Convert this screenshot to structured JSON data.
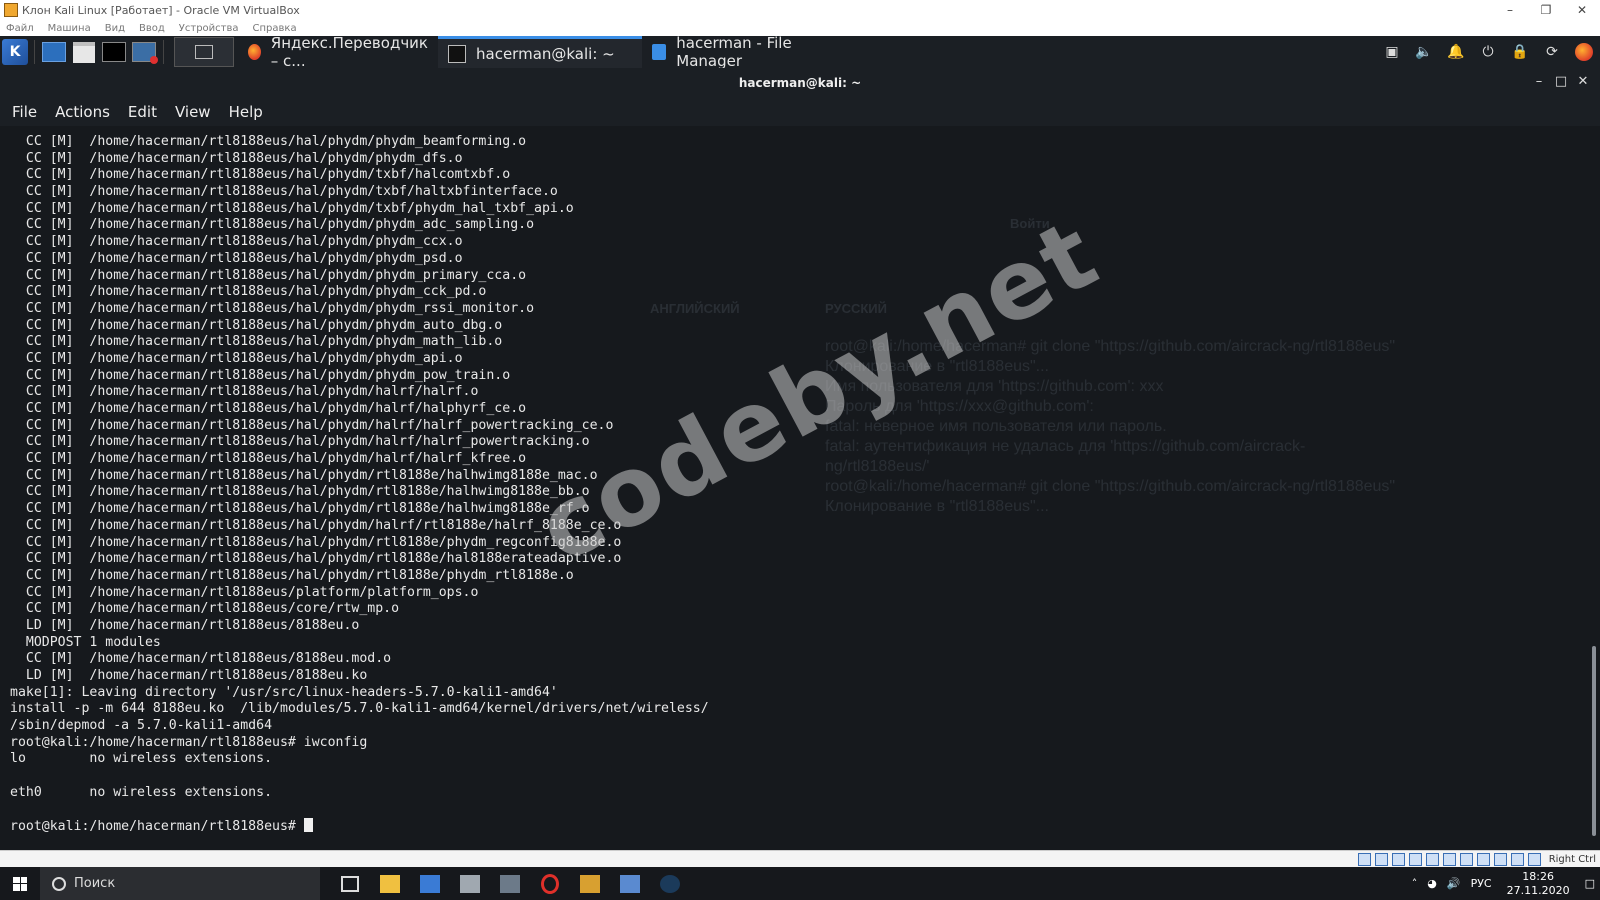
{
  "vbox": {
    "title": "Клон Kali Linux [Работает] - Oracle VM VirtualBox",
    "menu": [
      "Файл",
      "Машина",
      "Вид",
      "Ввод",
      "Устройства",
      "Справка"
    ],
    "host_key": "Right Ctrl"
  },
  "panel": {
    "tasks": [
      {
        "label": "Яндекс.Переводчик – с...",
        "icon": "firefox-icon",
        "active": false
      },
      {
        "label": "hacerman@kali: ~",
        "icon": "terminal-icon",
        "active": true
      },
      {
        "label": "hacerman - File Manager",
        "icon": "file-manager-icon",
        "active": false
      }
    ]
  },
  "terminal": {
    "title": "hacerman@kali: ~",
    "menu": [
      "File",
      "Actions",
      "Edit",
      "View",
      "Help"
    ],
    "lines": [
      "  CC [M]  /home/hacerman/rtl8188eus/hal/phydm/phydm_beamforming.o",
      "  CC [M]  /home/hacerman/rtl8188eus/hal/phydm/phydm_dfs.o",
      "  CC [M]  /home/hacerman/rtl8188eus/hal/phydm/txbf/halcomtxbf.o",
      "  CC [M]  /home/hacerman/rtl8188eus/hal/phydm/txbf/haltxbfinterface.o",
      "  CC [M]  /home/hacerman/rtl8188eus/hal/phydm/txbf/phydm_hal_txbf_api.o",
      "  CC [M]  /home/hacerman/rtl8188eus/hal/phydm/phydm_adc_sampling.o",
      "  CC [M]  /home/hacerman/rtl8188eus/hal/phydm/phydm_ccx.o",
      "  CC [M]  /home/hacerman/rtl8188eus/hal/phydm/phydm_psd.o",
      "  CC [M]  /home/hacerman/rtl8188eus/hal/phydm/phydm_primary_cca.o",
      "  CC [M]  /home/hacerman/rtl8188eus/hal/phydm/phydm_cck_pd.o",
      "  CC [M]  /home/hacerman/rtl8188eus/hal/phydm/phydm_rssi_monitor.o",
      "  CC [M]  /home/hacerman/rtl8188eus/hal/phydm/phydm_auto_dbg.o",
      "  CC [M]  /home/hacerman/rtl8188eus/hal/phydm/phydm_math_lib.o",
      "  CC [M]  /home/hacerman/rtl8188eus/hal/phydm/phydm_api.o",
      "  CC [M]  /home/hacerman/rtl8188eus/hal/phydm/phydm_pow_train.o",
      "  CC [M]  /home/hacerman/rtl8188eus/hal/phydm/halrf/halrf.o",
      "  CC [M]  /home/hacerman/rtl8188eus/hal/phydm/halrf/halphyrf_ce.o",
      "  CC [M]  /home/hacerman/rtl8188eus/hal/phydm/halrf/halrf_powertracking_ce.o",
      "  CC [M]  /home/hacerman/rtl8188eus/hal/phydm/halrf/halrf_powertracking.o",
      "  CC [M]  /home/hacerman/rtl8188eus/hal/phydm/halrf/halrf_kfree.o",
      "  CC [M]  /home/hacerman/rtl8188eus/hal/phydm/rtl8188e/halhwimg8188e_mac.o",
      "  CC [M]  /home/hacerman/rtl8188eus/hal/phydm/rtl8188e/halhwimg8188e_bb.o",
      "  CC [M]  /home/hacerman/rtl8188eus/hal/phydm/rtl8188e/halhwimg8188e_rf.o",
      "  CC [M]  /home/hacerman/rtl8188eus/hal/phydm/halrf/rtl8188e/halrf_8188e_ce.o",
      "  CC [M]  /home/hacerman/rtl8188eus/hal/phydm/rtl8188e/phydm_regconfig8188e.o",
      "  CC [M]  /home/hacerman/rtl8188eus/hal/phydm/rtl8188e/hal8188erateadaptive.o",
      "  CC [M]  /home/hacerman/rtl8188eus/hal/phydm/rtl8188e/phydm_rtl8188e.o",
      "  CC [M]  /home/hacerman/rtl8188eus/platform/platform_ops.o",
      "  CC [M]  /home/hacerman/rtl8188eus/core/rtw_mp.o",
      "  LD [M]  /home/hacerman/rtl8188eus/8188eu.o",
      "  MODPOST 1 modules",
      "  CC [M]  /home/hacerman/rtl8188eus/8188eu.mod.o",
      "  LD [M]  /home/hacerman/rtl8188eus/8188eu.ko",
      "make[1]: Leaving directory '/usr/src/linux-headers-5.7.0-kali1-amd64'",
      "install -p -m 644 8188eu.ko  /lib/modules/5.7.0-kali1-amd64/kernel/drivers/net/wireless/",
      "/sbin/depmod -a 5.7.0-kali1-amd64",
      "root@kali:/home/hacerman/rtl8188eus# iwconfig",
      "lo        no wireless extensions.",
      "",
      "eth0      no wireless extensions.",
      ""
    ],
    "prompt": "root@kali:/home/hacerman/rtl8188eus# "
  },
  "background_window": {
    "ghost_text": [
      "root@kali:/home/hacerman# git clone \"https://github.com/aircrack-ng/rtl8188eus\"",
      "Клонирование в \"rtl8188eus\"...",
      "Имя пользователя для 'https://github.com': xxx",
      "Пароль для 'https://xxx@github.com':",
      "fatal: неверное имя пользователя или пароль.",
      "fatal: аутентификация не удалась для 'https://github.com/aircrack-",
      "ng/rtl8188eus/'",
      "root@kali:/home/hacerman# git clone \"https://github.com/aircrack-ng/rtl8188eus\"",
      "Клонирование в \"rtl8188eus\"..."
    ],
    "login_label": "Войти",
    "lang_from": "АНГЛИЙСКИЙ",
    "lang_to": "РУССКИЙ"
  },
  "watermark": "codeby.net",
  "taskbar": {
    "search_placeholder": "Поиск",
    "lang": "РУС",
    "time": "18:26",
    "date": "27.11.2020"
  },
  "colors": {
    "terminal_bg": "#16191d",
    "terminal_fg": "#e8e8e8",
    "accent": "#3a8ee6"
  }
}
